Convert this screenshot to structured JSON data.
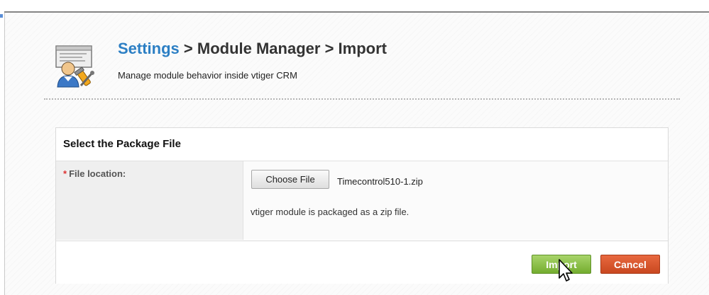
{
  "header": {
    "breadcrumb": {
      "settings": "Settings",
      "separator1": " > ",
      "module_manager": "Module Manager",
      "separator2": " > ",
      "current": "Import"
    },
    "subtitle": "Manage module behavior inside vtiger CRM",
    "icon": "module-manager-icon"
  },
  "panel": {
    "title": "Select the Package File",
    "field": {
      "required_mark": "*",
      "label": "File location:",
      "choose_button": "Choose File",
      "selected_file": "Timecontrol510-1.zip",
      "hint": "vtiger module is packaged as a zip file."
    },
    "actions": {
      "import": "Import",
      "cancel": "Cancel"
    }
  },
  "colors": {
    "link": "#2c7fc4",
    "import": "#7db63a",
    "cancel": "#d8532a"
  }
}
